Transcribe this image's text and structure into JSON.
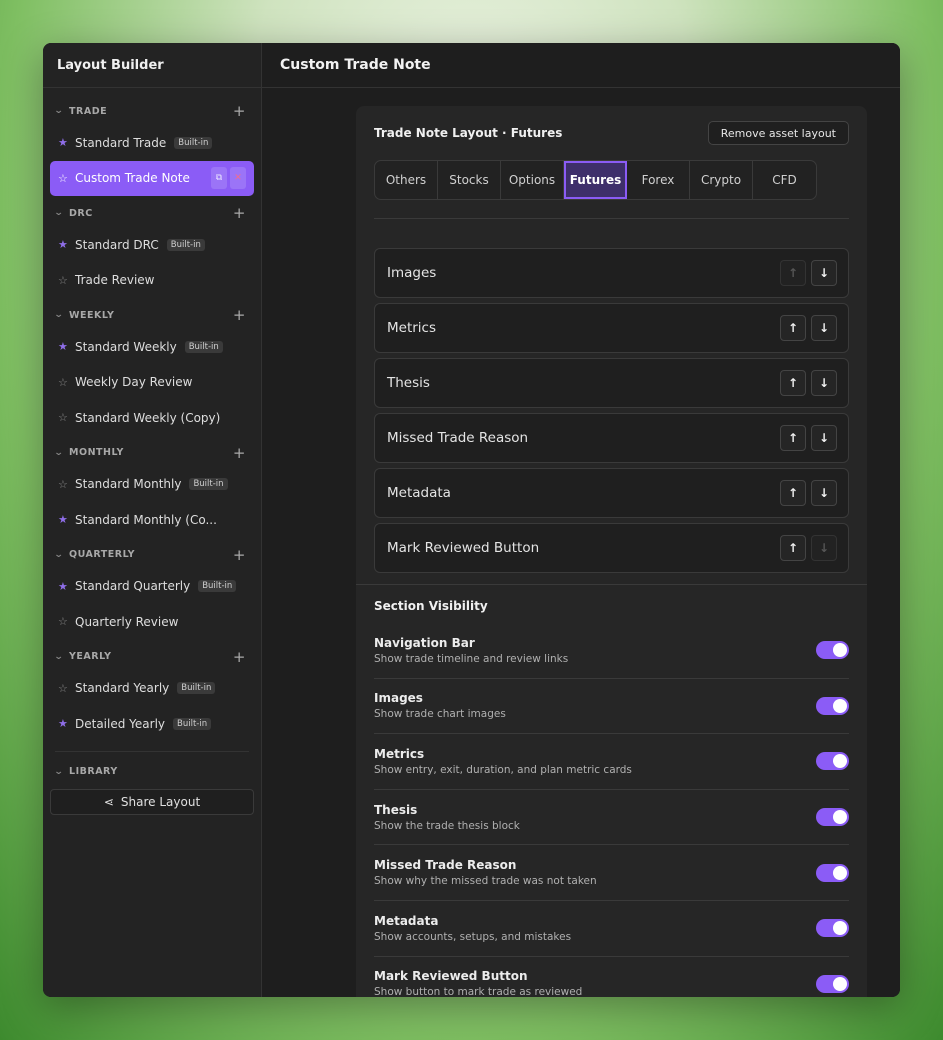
{
  "sidebar": {
    "title": "Layout Builder",
    "groups": [
      {
        "name": "TRADE",
        "items": [
          {
            "label": "Standard Trade",
            "badge": "Built-in",
            "starred": true
          },
          {
            "label": "Custom Trade Note",
            "badge": "",
            "starred": false,
            "active": true
          }
        ]
      },
      {
        "name": "DRC",
        "items": [
          {
            "label": "Standard DRC",
            "badge": "Built-in",
            "starred": true
          },
          {
            "label": "Trade Review",
            "badge": "",
            "starred": false
          }
        ]
      },
      {
        "name": "WEEKLY",
        "items": [
          {
            "label": "Standard Weekly",
            "badge": "Built-in",
            "starred": true
          },
          {
            "label": "Weekly Day Review",
            "badge": "",
            "starred": false
          },
          {
            "label": "Standard Weekly (Copy)",
            "badge": "",
            "starred": false
          }
        ]
      },
      {
        "name": "MONTHLY",
        "items": [
          {
            "label": "Standard Monthly",
            "badge": "Built-in",
            "starred": false
          },
          {
            "label": "Standard Monthly (Co...",
            "badge": "",
            "starred": true
          }
        ]
      },
      {
        "name": "QUARTERLY",
        "items": [
          {
            "label": "Standard Quarterly",
            "badge": "Built-in",
            "starred": true
          },
          {
            "label": "Quarterly Review",
            "badge": "",
            "starred": false
          }
        ]
      },
      {
        "name": "YEARLY",
        "items": [
          {
            "label": "Standard Yearly",
            "badge": "Built-in",
            "starred": false
          },
          {
            "label": "Detailed Yearly",
            "badge": "Built-in",
            "starred": true
          }
        ]
      }
    ],
    "library_label": "LIBRARY",
    "share_label": "Share Layout"
  },
  "main": {
    "title": "Custom Trade Note",
    "panel_title": "Trade Note Layout · Futures",
    "remove_label": "Remove asset layout",
    "tabs": [
      "Others",
      "Stocks",
      "Options",
      "Futures",
      "Forex",
      "Crypto",
      "CFD"
    ],
    "active_tab": "Futures",
    "sections": [
      {
        "label": "Images",
        "up_disabled": true,
        "down_disabled": false
      },
      {
        "label": "Metrics",
        "up_disabled": false,
        "down_disabled": false
      },
      {
        "label": "Thesis",
        "up_disabled": false,
        "down_disabled": false
      },
      {
        "label": "Missed Trade Reason",
        "up_disabled": false,
        "down_disabled": false
      },
      {
        "label": "Metadata",
        "up_disabled": false,
        "down_disabled": false
      },
      {
        "label": "Mark Reviewed Button",
        "up_disabled": false,
        "down_disabled": true
      }
    ],
    "visibility_title": "Section Visibility",
    "visibility": [
      {
        "name": "Navigation Bar",
        "desc": "Show trade timeline and review links",
        "on": true
      },
      {
        "name": "Images",
        "desc": "Show trade chart images",
        "on": true
      },
      {
        "name": "Metrics",
        "desc": "Show entry, exit, duration, and plan metric cards",
        "on": true
      },
      {
        "name": "Thesis",
        "desc": "Show the trade thesis block",
        "on": true
      },
      {
        "name": "Missed Trade Reason",
        "desc": "Show why the missed trade was not taken",
        "on": true
      },
      {
        "name": "Metadata",
        "desc": "Show accounts, setups, and mistakes",
        "on": true
      },
      {
        "name": "Mark Reviewed Button",
        "desc": "Show button to mark trade as reviewed",
        "on": true
      }
    ]
  },
  "colors": {
    "accent": "#8b5cf6",
    "sidebar_bg": "#232323",
    "panel_bg": "#262626"
  }
}
